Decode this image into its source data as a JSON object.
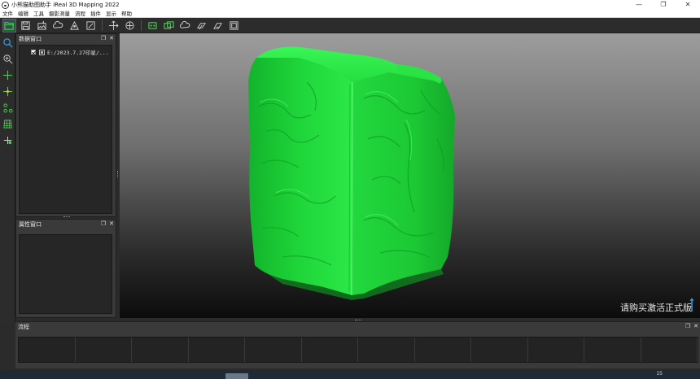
{
  "window": {
    "title": "小熊猫助图助手 iReal 3D Mapping 2022",
    "controls": [
      "—",
      "❐",
      "✕"
    ]
  },
  "menu": [
    "文件",
    "编辑",
    "工具",
    "摄影测量",
    "流程",
    "插件",
    "显示",
    "帮助"
  ],
  "toolbar": {
    "icons": [
      "open-folder-icon",
      "save-icon",
      "import-image-icon",
      "cloud-icon",
      "measure-icon",
      "edit-icon",
      "move-icon",
      "rotate-icon",
      "align-icon",
      "align-all-icon",
      "cloud-sync-icon",
      "copy-layer-icon",
      "layer-stack-icon",
      "frame-icon"
    ]
  },
  "left_tools": [
    "zoom-icon",
    "zoom-region-icon",
    "add-point-icon",
    "center-point-icon",
    "connect-icon",
    "grid-icon",
    "move-cross-icon"
  ],
  "data_panel": {
    "title": "数据窗口",
    "items": [
      {
        "label": "E:/2023.7.27印星/...",
        "checked": true
      }
    ]
  },
  "property_panel": {
    "title": "属性窗口"
  },
  "viewport": {
    "watermark": "请购买激活正式版",
    "mesh_color": "#1fdc3a"
  },
  "flow_panel": {
    "title": "流程",
    "cells": 12
  },
  "taskbar": {
    "text": "15"
  },
  "colors": {
    "accent_green": "#44d24a",
    "accent_blue": "#3aa0dc",
    "panel": "#3a3a3a"
  }
}
